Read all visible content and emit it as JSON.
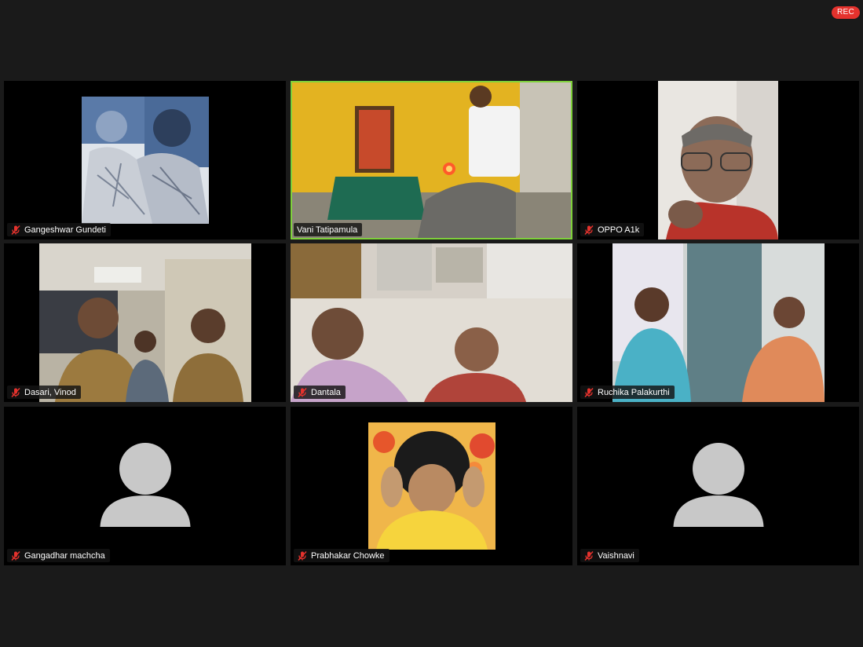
{
  "recording": {
    "label": "REC",
    "color": "#e5322d"
  },
  "participants": [
    {
      "name": "Gangeshwar Gundeti",
      "muted": true,
      "video": "photo"
    },
    {
      "name": "Vani Tatipamula",
      "muted": false,
      "video": "camera",
      "active_speaker": true
    },
    {
      "name": "OPPO A1k",
      "muted": true,
      "video": "camera"
    },
    {
      "name": "Dasari, Vinod",
      "muted": true,
      "video": "camera"
    },
    {
      "name": "Dantala",
      "muted": true,
      "video": "camera"
    },
    {
      "name": "Ruchika Palakurthi",
      "muted": true,
      "video": "camera"
    },
    {
      "name": "Gangadhar machcha",
      "muted": true,
      "video": "off"
    },
    {
      "name": "Prabhakar Chowke",
      "muted": true,
      "video": "photo"
    },
    {
      "name": "Vaishnavi",
      "muted": true,
      "video": "off"
    }
  ],
  "icons": {
    "mute": "microphone-muted-icon",
    "avatar": "default-avatar-icon"
  },
  "colors": {
    "active_border": "#7fd13b",
    "mute_red": "#e5322d",
    "background": "#1a1a1a"
  }
}
